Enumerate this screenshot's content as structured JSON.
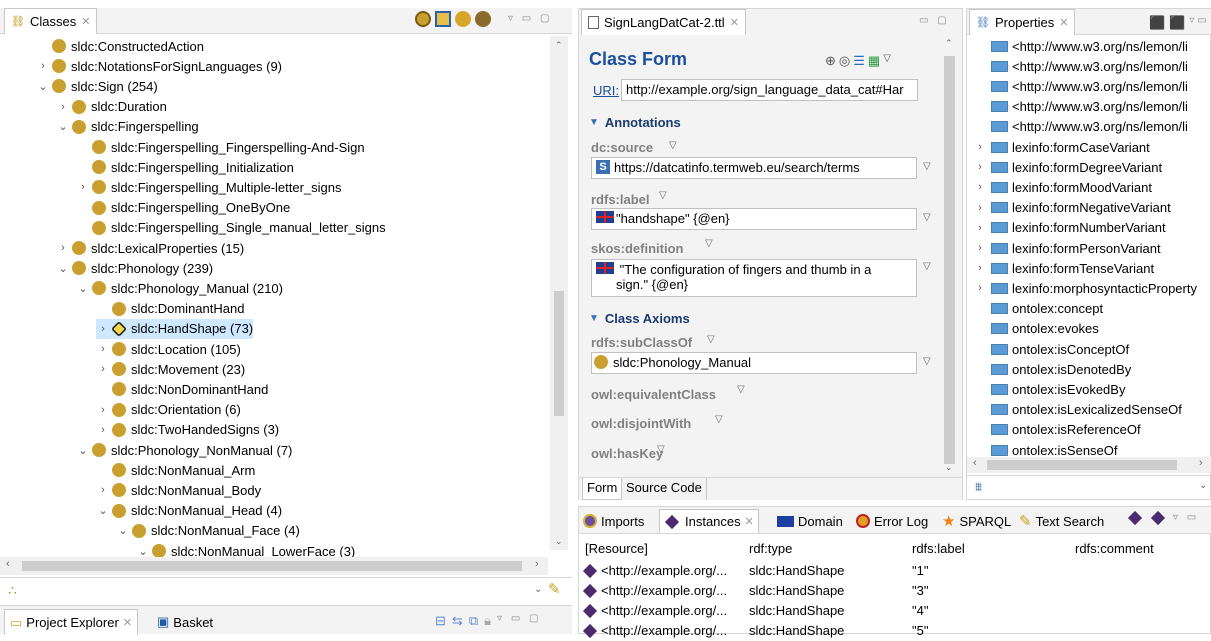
{
  "classes_view": {
    "tab_label": "Classes",
    "close": "✕",
    "rows": [
      {
        "label": "sldc:ConstructedAction",
        "toggle": ""
      },
      {
        "label": "sldc:NotationsForSignLanguages  (9)",
        "toggle": ">"
      },
      {
        "label": "sldc:Sign  (254)",
        "toggle": "v"
      },
      {
        "label": "sldc:Duration",
        "toggle": ">"
      },
      {
        "label": "sldc:Fingerspelling",
        "toggle": "v"
      },
      {
        "label": "sldc:Fingerspelling_Fingerspelling-And-Sign",
        "toggle": ""
      },
      {
        "label": "sldc:Fingerspelling_Initialization",
        "toggle": ""
      },
      {
        "label": "sldc:Fingerspelling_Multiple-letter_signs",
        "toggle": ">"
      },
      {
        "label": "sldc:Fingerspelling_OneByOne",
        "toggle": ""
      },
      {
        "label": "sldc:Fingerspelling_Single_manual_letter_signs",
        "toggle": ""
      },
      {
        "label": "sldc:LexicalProperties  (15)",
        "toggle": ">"
      },
      {
        "label": "sldc:Phonology  (239)",
        "toggle": "v"
      },
      {
        "label": "sldc:Phonology_Manual  (210)",
        "toggle": "v"
      },
      {
        "label": "sldc:DominantHand",
        "toggle": ""
      },
      {
        "label": "sldc:HandShape  (73)",
        "toggle": ">"
      },
      {
        "label": "sldc:Location  (105)",
        "toggle": ">"
      },
      {
        "label": "sldc:Movement  (23)",
        "toggle": ">"
      },
      {
        "label": "sldc:NonDominantHand",
        "toggle": ""
      },
      {
        "label": "sldc:Orientation  (6)",
        "toggle": ">"
      },
      {
        "label": "sldc:TwoHandedSigns  (3)",
        "toggle": ">"
      },
      {
        "label": "sldc:Phonology_NonManual  (7)",
        "toggle": "v"
      },
      {
        "label": "sldc:NonManual_Arm",
        "toggle": ""
      },
      {
        "label": "sldc:NonManual_Body",
        "toggle": ">"
      },
      {
        "label": "sldc:NonManual_Head  (4)",
        "toggle": "v"
      },
      {
        "label": "sldc:NonManual_Face  (4)",
        "toggle": "v"
      },
      {
        "label": "sldc:NonManual_LowerFace  (3)",
        "toggle": "v"
      }
    ]
  },
  "project_tabs": {
    "explorer": "Project Explorer",
    "basket": "Basket"
  },
  "editor": {
    "tab_label": "SignLangDatCat-2.ttl",
    "title": "Class Form",
    "uri_label": "URI:",
    "uri_value": "http://example.org/sign_language_data_cat#Har",
    "annotations_header": "Annotations",
    "dc_source_label": "dc:source",
    "dc_source_value": "https://datcatinfo.termweb.eu/search/terms",
    "rdfs_label_label": "rdfs:label",
    "rdfs_label_value": "\"handshape\" {@en}",
    "skos_def_label": "skos:definition",
    "skos_def_value_1": "\"The configuration of fingers and thumb in a",
    "skos_def_value_2": "sign.\" {@en}",
    "axioms_header": "Class Axioms",
    "subclass_label": "rdfs:subClassOf",
    "subclass_value": "sldc:Phonology_Manual",
    "equiv_label": "owl:equivalentClass",
    "disjoint_label": "owl:disjointWith",
    "haskey_label": "owl:hasKey",
    "tab_form": "Form",
    "tab_source": "Source Code"
  },
  "properties_view": {
    "tab_label": "Properties",
    "rows": [
      {
        "label": "<http://www.w3.org/ns/lemon/li",
        "toggle": ""
      },
      {
        "label": "<http://www.w3.org/ns/lemon/li",
        "toggle": ""
      },
      {
        "label": "<http://www.w3.org/ns/lemon/li",
        "toggle": ""
      },
      {
        "label": "<http://www.w3.org/ns/lemon/li",
        "toggle": ""
      },
      {
        "label": "<http://www.w3.org/ns/lemon/li",
        "toggle": ""
      },
      {
        "label": "lexinfo:formCaseVariant",
        "toggle": ">"
      },
      {
        "label": "lexinfo:formDegreeVariant",
        "toggle": ">"
      },
      {
        "label": "lexinfo:formMoodVariant",
        "toggle": ">"
      },
      {
        "label": "lexinfo:formNegativeVariant",
        "toggle": ">"
      },
      {
        "label": "lexinfo:formNumberVariant",
        "toggle": ">"
      },
      {
        "label": "lexinfo:formPersonVariant",
        "toggle": ">"
      },
      {
        "label": "lexinfo:formTenseVariant",
        "toggle": ">"
      },
      {
        "label": "lexinfo:morphosyntacticProperty",
        "toggle": ">"
      },
      {
        "label": "ontolex:concept",
        "toggle": ""
      },
      {
        "label": "ontolex:evokes",
        "toggle": ""
      },
      {
        "label": "ontolex:isConceptOf",
        "toggle": ""
      },
      {
        "label": "ontolex:isDenotedBy",
        "toggle": ""
      },
      {
        "label": "ontolex:isEvokedBy",
        "toggle": ""
      },
      {
        "label": "ontolex:isLexicalizedSenseOf",
        "toggle": ""
      },
      {
        "label": "ontolex:isReferenceOf",
        "toggle": ""
      },
      {
        "label": "ontolex:isSenseOf",
        "toggle": ""
      }
    ]
  },
  "bottom_tabs": {
    "imports": "Imports",
    "instances": "Instances",
    "domain": "Domain",
    "error_log": "Error Log",
    "sparql": "SPARQL",
    "text_search": "Text Search"
  },
  "instances_table": {
    "headers": [
      "[Resource]",
      "rdf:type",
      "rdfs:label",
      "rdfs:comment"
    ],
    "rows": [
      [
        "<http://example.org/...",
        "sldc:HandShape",
        "\"1\"",
        ""
      ],
      [
        "<http://example.org/...",
        "sldc:HandShape",
        "\"3\"",
        ""
      ],
      [
        "<http://example.org/...",
        "sldc:HandShape",
        "\"4\"",
        ""
      ],
      [
        "<http://example.org/...",
        "sldc:HandShape",
        "\"5\"",
        ""
      ]
    ]
  }
}
